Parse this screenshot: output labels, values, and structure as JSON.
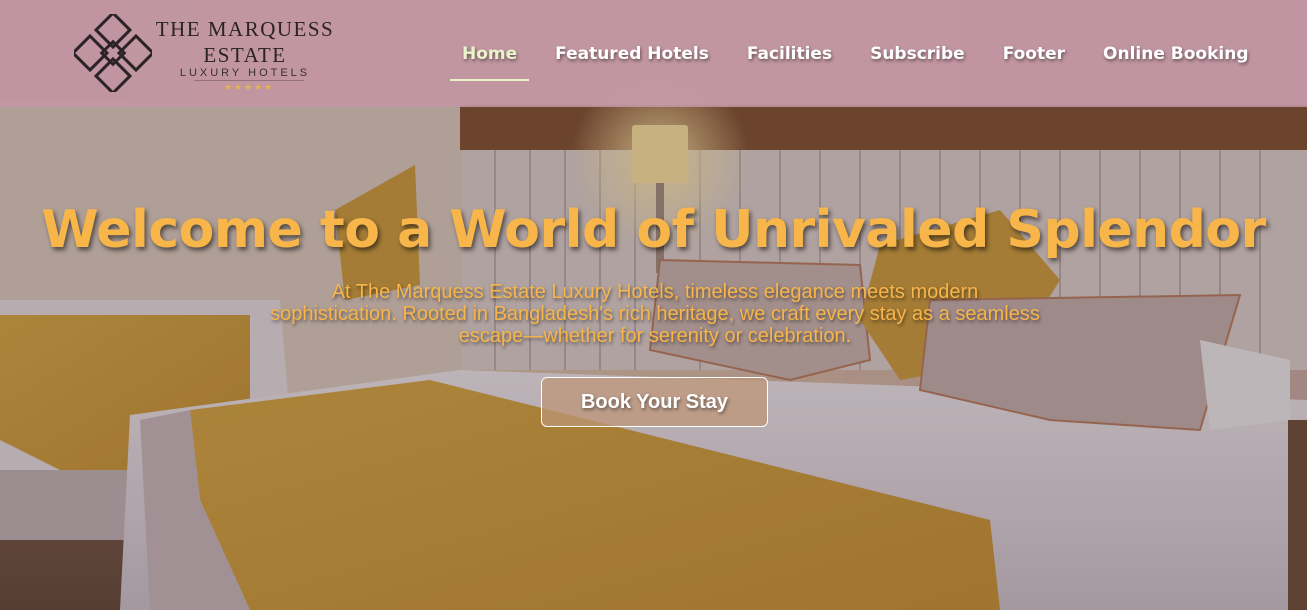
{
  "brand": {
    "title_line1": "THE MARQUESS",
    "title_line2": "ESTATE",
    "subtitle": "LUXURY HOTELS",
    "stars": "★★★★★",
    "star_color": "#e4b44c"
  },
  "nav": {
    "items": [
      {
        "label": "Home",
        "active": true
      },
      {
        "label": "Featured Hotels",
        "active": false
      },
      {
        "label": "Facilities",
        "active": false
      },
      {
        "label": "Subscribe",
        "active": false
      },
      {
        "label": "Footer",
        "active": false
      },
      {
        "label": "Online Booking",
        "active": false
      }
    ]
  },
  "hero": {
    "title": "Welcome to a World of Unrivaled Splendor",
    "description": "At The Marquess Estate Luxury Hotels, timeless elegance meets modern sophistication. Rooted in Bangladesh's rich heritage, we craft every stay as a seamless escape—whether for serenity or celebration.",
    "cta_label": "Book Your Stay"
  },
  "colors": {
    "accent": "#f7b54a",
    "header_bg": "#c496a5",
    "active_nav": "#e9f5c8"
  }
}
